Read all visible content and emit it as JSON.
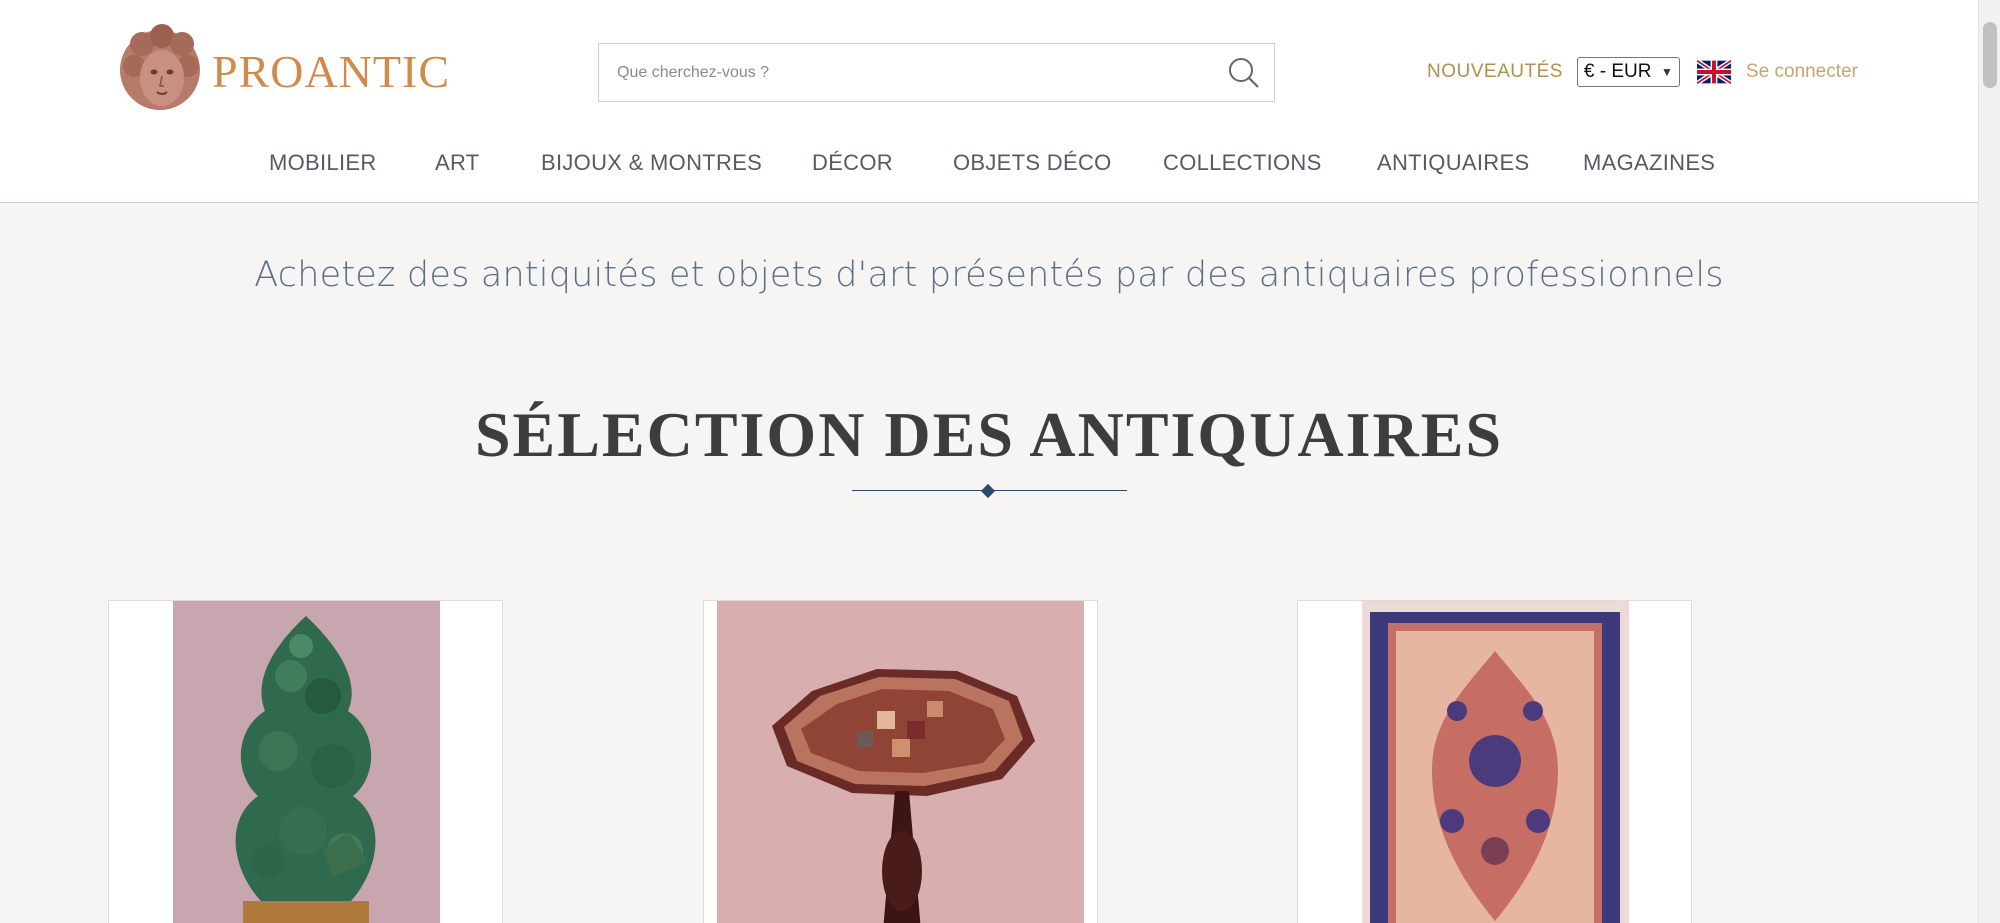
{
  "header": {
    "logo_text": "PROANTIC",
    "search": {
      "placeholder": "Que cherchez-vous ?"
    },
    "nouveautes": "NOUVEAUTÉS",
    "currency": "€ - EUR",
    "language_flag": "uk-flag-icon",
    "login": "Se connecter"
  },
  "nav": {
    "items": [
      "MOBILIER",
      "ART",
      "BIJOUX & MONTRES",
      "DÉCOR",
      "OBJETS DÉCO",
      "COLLECTIONS",
      "ANTIQUAIRES",
      "MAGAZINES"
    ]
  },
  "main": {
    "tagline": "Achetez des antiquités et objets d'art présentés par des antiquaires professionnels",
    "section_title": "SÉLECTION DES ANTIQUAIRES"
  },
  "colors": {
    "brand": "#d08a4a",
    "nav_text": "#555b65",
    "tagline": "#5c6e86",
    "gold": "#b0904e"
  }
}
